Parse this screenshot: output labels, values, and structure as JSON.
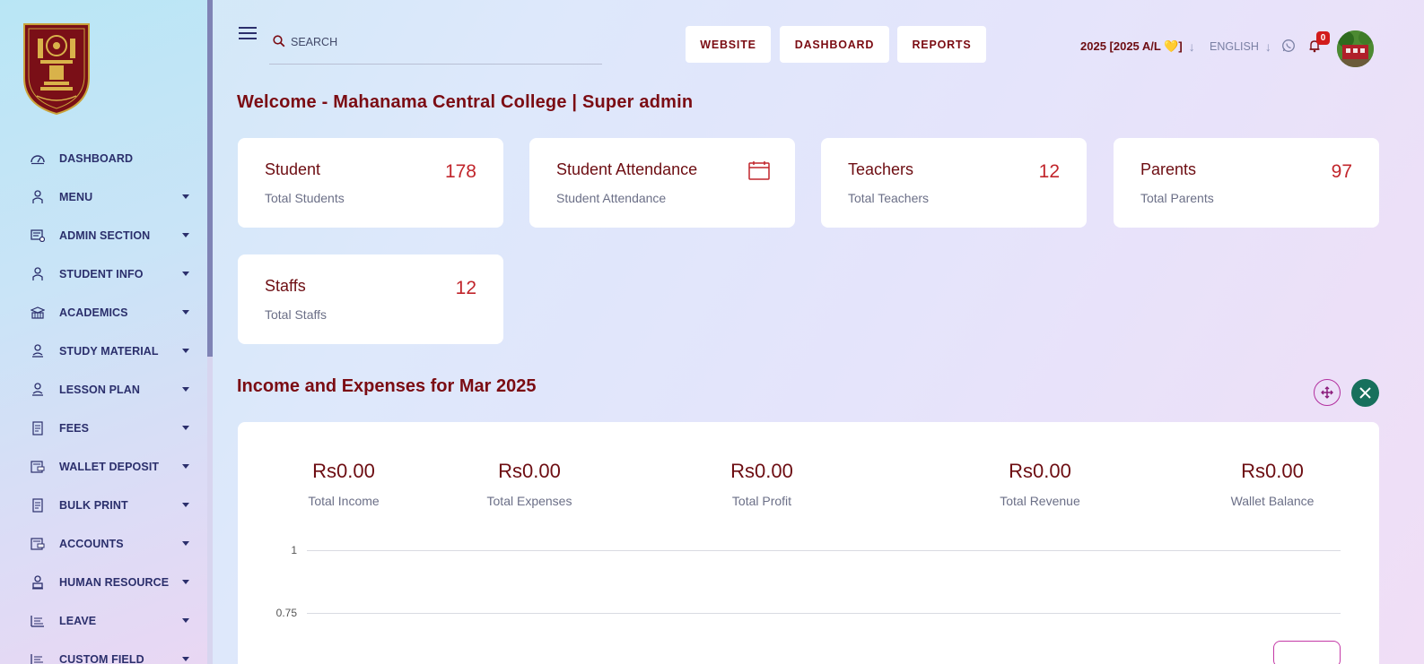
{
  "sidebar": {
    "items": [
      {
        "label": "DASHBOARD",
        "icon": "dashboard-icon",
        "has_submenu": false
      },
      {
        "label": "MENU",
        "icon": "menu-user-icon",
        "has_submenu": true
      },
      {
        "label": "ADMIN SECTION",
        "icon": "admin-icon",
        "has_submenu": true
      },
      {
        "label": "STUDENT INFO",
        "icon": "student-icon",
        "has_submenu": true
      },
      {
        "label": "ACADEMICS",
        "icon": "academics-icon",
        "has_submenu": true
      },
      {
        "label": "STUDY MATERIAL",
        "icon": "study-material-icon",
        "has_submenu": true
      },
      {
        "label": "LESSON PLAN",
        "icon": "lesson-plan-icon",
        "has_submenu": true
      },
      {
        "label": "FEES",
        "icon": "fees-icon",
        "has_submenu": true
      },
      {
        "label": "WALLET DEPOSIT",
        "icon": "wallet-icon",
        "has_submenu": true
      },
      {
        "label": "BULK PRINT",
        "icon": "print-icon",
        "has_submenu": true
      },
      {
        "label": "ACCOUNTS",
        "icon": "accounts-icon",
        "has_submenu": true
      },
      {
        "label": "HUMAN RESOURCE",
        "icon": "human-resource-icon",
        "has_submenu": true
      },
      {
        "label": "LEAVE",
        "icon": "leave-icon",
        "has_submenu": true
      },
      {
        "label": "CUSTOM FIELD",
        "icon": "custom-field-icon",
        "has_submenu": true
      }
    ]
  },
  "header": {
    "search_placeholder": "SEARCH",
    "website_label": "WEBSITE",
    "dashboard_label": "DASHBOARD",
    "reports_label": "REPORTS",
    "session": "2025 [2025 A/L 💛]",
    "language": "ENGLISH",
    "notification_count": "0"
  },
  "welcome": "Welcome - Mahanama Central College | Super admin",
  "stats": {
    "student": {
      "title": "Student",
      "subtitle": "Total Students",
      "value": "178"
    },
    "attendance": {
      "title": "Student Attendance",
      "subtitle": "Student Attendance"
    },
    "teachers": {
      "title": "Teachers",
      "subtitle": "Total Teachers",
      "value": "12"
    },
    "parents": {
      "title": "Parents",
      "subtitle": "Total Parents",
      "value": "97"
    },
    "staffs": {
      "title": "Staffs",
      "subtitle": "Total Staffs",
      "value": "12"
    }
  },
  "income": {
    "title": "Income and Expenses for Mar 2025",
    "items": [
      {
        "value": "Rs0.00",
        "label": "Total Income"
      },
      {
        "value": "Rs0.00",
        "label": "Total Expenses"
      },
      {
        "value": "Rs0.00",
        "label": "Total Profit"
      },
      {
        "value": "Rs0.00",
        "label": "Total Revenue"
      },
      {
        "value": "Rs0.00",
        "label": "Wallet Balance"
      }
    ],
    "y_ticks": [
      "1",
      "0.75"
    ]
  },
  "colors": {
    "brand_dark": "#7b0c13",
    "accent_red": "#c1252b",
    "close_green": "#17705c"
  }
}
